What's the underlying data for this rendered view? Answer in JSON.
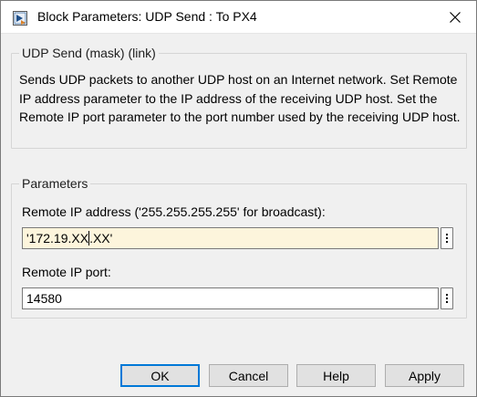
{
  "window": {
    "title": "Block Parameters: UDP Send : To PX4",
    "icon": "simulink-block-icon",
    "close_icon": "close-icon"
  },
  "mask": {
    "header": "UDP Send (mask) (link)",
    "description": "Sends UDP packets to another UDP host on an Internet network. Set Remote IP address parameter to the IP address of the receiving UDP host. Set the Remote IP port parameter to the port number used by the receiving UDP host."
  },
  "parameters": {
    "header": "Parameters",
    "remote_ip": {
      "label": "Remote IP address ('255.255.255.255' for broadcast):",
      "value_before_caret": "'172.19.XX",
      "value_after_caret": ".XX'"
    },
    "remote_port": {
      "label": "Remote IP port:",
      "value": "14580"
    }
  },
  "buttons": {
    "ok": "OK",
    "cancel": "Cancel",
    "help": "Help",
    "apply": "Apply"
  },
  "colors": {
    "active_field": "#fdf5dc",
    "default_button_border": "#0078d7",
    "dialog_background": "#f0f0f0"
  }
}
